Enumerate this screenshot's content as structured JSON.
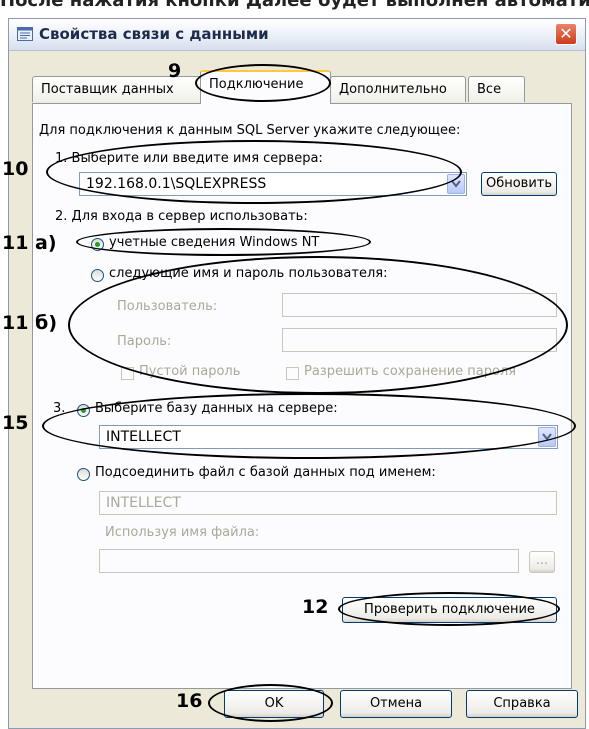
{
  "top_cut_text": "После нажатия кнопки Далее будет выполнен автоматический переход...",
  "dialog": {
    "title": "Свойства связи с данными",
    "close_glyph": "✕"
  },
  "tabs": [
    {
      "label": "Поставщик данных",
      "active": false
    },
    {
      "label": "Подключение",
      "active": true
    },
    {
      "label": "Дополнительно",
      "active": false
    },
    {
      "label": "Все",
      "active": false
    }
  ],
  "connection": {
    "intro": "Для подключения к данным SQL Server укажите следующее:",
    "step1_label": "1. Выберите или введите имя сервера:",
    "server_value": "192.168.0.1\\SQLEXPRESS",
    "refresh_button": "Обновить",
    "step2_label": "2. Для входа в сервер использовать:",
    "auth_windows_label": "учетные сведения Windows NT",
    "auth_windows_checked": true,
    "auth_user_label": "следующие имя и пароль пользователя:",
    "auth_user_checked": false,
    "user_label": "Пользователь:",
    "user_value": "",
    "password_label": "Пароль:",
    "password_value": "",
    "blank_password_label": "Пустой пароль",
    "allow_save_password_label": "Разрешить сохранение пароля",
    "step3_prefix": "3.",
    "db_select_label": "Выберите базу данных на сервере:",
    "db_select_checked": true,
    "database_value": "INTELLECT",
    "attach_file_label": "Подсоединить файл с базой данных под именем:",
    "attach_file_checked": false,
    "attach_name_value": "INTELLECT",
    "file_name_label": "Используя имя файла:",
    "file_name_value": "",
    "browse_button": "...",
    "test_button": "Проверить подключение"
  },
  "footer": {
    "ok_button": "OK",
    "cancel_button": "Отмена",
    "help_button": "Справка"
  },
  "annotations": {
    "a9": "9",
    "a10": "10",
    "a11a": "11 а)",
    "a11b": "11 б)",
    "a15": "15",
    "a12": "12",
    "a16": "16"
  },
  "colors": {
    "dialog_bg": "#ece9d8",
    "panel_bg": "#fcfcfe",
    "active_tab_accent": "#ffc83c",
    "radio_checked": "#21a121",
    "close_button": "#cd3b19",
    "disabled_text": "#aca899"
  }
}
